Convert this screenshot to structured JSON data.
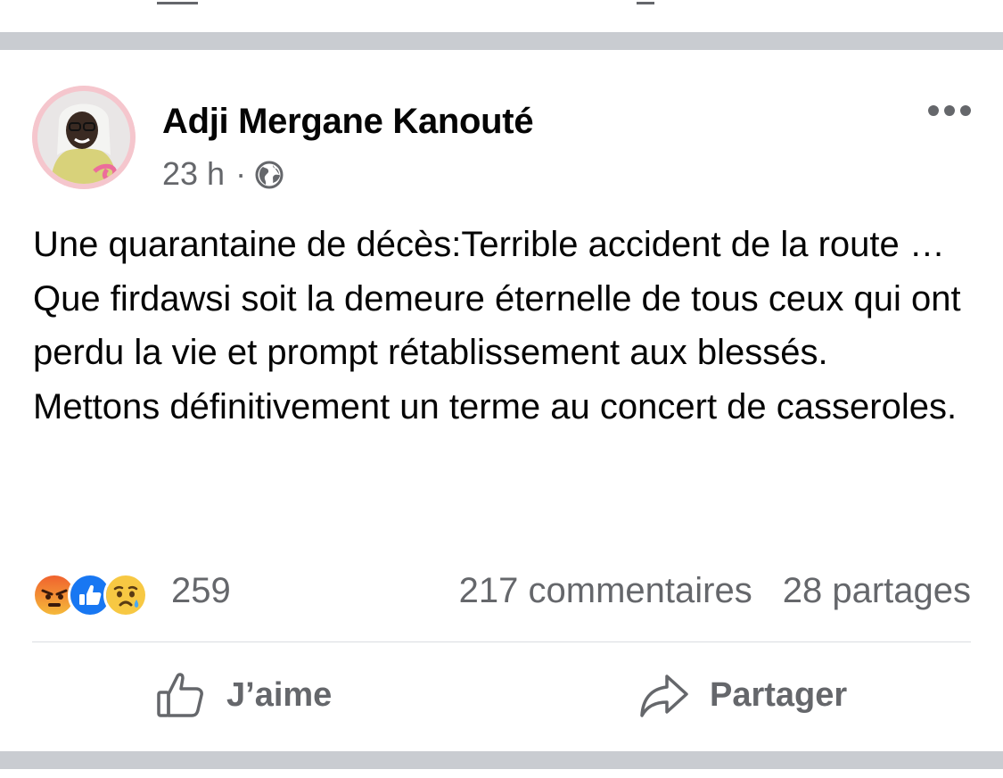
{
  "post": {
    "author": "Adji Mergane Kanouté",
    "time": "23 h",
    "separator": "·",
    "privacy_icon": "globe-icon",
    "more_icon": "more-options-icon",
    "content": [
      "Une quarantaine de décès:Terrible accident de la route … Que firdawsi soit la demeure éternelle de tous ceux qui ont perdu la vie et prompt rétablissement aux blessés.",
      "Mettons définitivement un terme au concert de casseroles."
    ]
  },
  "stats": {
    "reaction_icons": [
      "angry-reaction-icon",
      "like-reaction-icon",
      "sad-reaction-icon"
    ],
    "reaction_count": "259",
    "comments": "217 commentaires",
    "shares": "28 partages"
  },
  "actions": {
    "like_label": "J’aime",
    "share_label": "Partager"
  },
  "colors": {
    "secondary_text": "#65676b",
    "like_blue": "#1877f2",
    "angry_orange": "#f0622e",
    "sad_yellow": "#f7c843",
    "divider": "#c9ccd1"
  }
}
